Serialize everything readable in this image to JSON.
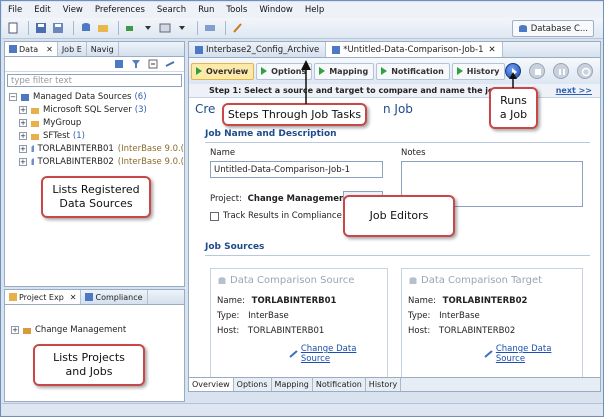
{
  "menubar": {
    "items": [
      "File",
      "Edit",
      "View",
      "Preferences",
      "Search",
      "Run",
      "Tools",
      "Window",
      "Help"
    ]
  },
  "toolbar": {
    "perspective_label": "Database C..."
  },
  "left_panel": {
    "tabs": [
      "Data",
      "Job E",
      "Navig"
    ],
    "filter_placeholder": "type filter text",
    "tree": [
      {
        "label": "Managed Data Sources",
        "count": "(6)"
      },
      {
        "label": "Microsoft SQL Server",
        "count": "(3)"
      },
      {
        "label": "MyGroup",
        "count": ""
      },
      {
        "label": "SFTest",
        "count": "(1)"
      },
      {
        "label": "TORLABINTERB01",
        "detail": "(InterBase 9.0.("
      },
      {
        "label": "TORLABINTERB02",
        "detail": "(InterBase 9.0.("
      }
    ]
  },
  "project_panel": {
    "tabs": [
      "Project Exp",
      "Compliance"
    ],
    "tree": [
      {
        "label": "Change Management"
      }
    ]
  },
  "editor": {
    "tabs": [
      "Interbase2_Config_Archive",
      "*Untitled-Data-Comparison-Job-1"
    ],
    "steps": [
      "Overview",
      "Options",
      "Mapping",
      "Notification",
      "History"
    ],
    "step1_text": "Step 1: Select a source and target to compare and name the job",
    "next_label": "next >>",
    "title": "Cre",
    "title_tail": "n Job",
    "section_name": "Job Name and Description",
    "name_label": "Name",
    "name_value": "Untitled-Data-Comparison-Job-1",
    "notes_label": "Notes",
    "project_label": "Project:",
    "project_value": "Change Management",
    "track_label": "Track Results in Compliance Exp",
    "section_sources": "Job Sources",
    "source": {
      "title": "Data Comparison Source",
      "name_label": "Name:",
      "name": "TORLABINTERB01",
      "type_label": "Type:",
      "type": "InterBase",
      "host_label": "Host:",
      "host": "TORLABINTERB01",
      "link": "Change Data Source"
    },
    "target": {
      "title": "Data Comparison Target",
      "name_label": "Name:",
      "name": "TORLABINTERB02",
      "type_label": "Type:",
      "type": "InterBase",
      "host_label": "Host:",
      "host": "TORLABINTERB02",
      "link": "Change Data Source"
    },
    "bottom_tabs": [
      "Overview",
      "Options",
      "Mapping",
      "Notification",
      "History"
    ]
  },
  "callouts": {
    "steps": "Steps Through Job Tasks",
    "runs": "Runs\na Job",
    "registered": "Lists Registered\nData Sources",
    "editors": "Job Editors",
    "projects": "Lists Projects\nand Jobs"
  },
  "colors": {
    "accent": "#2f5fb0",
    "callout_border": "#c8484a",
    "active_step": "#fde9a8"
  }
}
